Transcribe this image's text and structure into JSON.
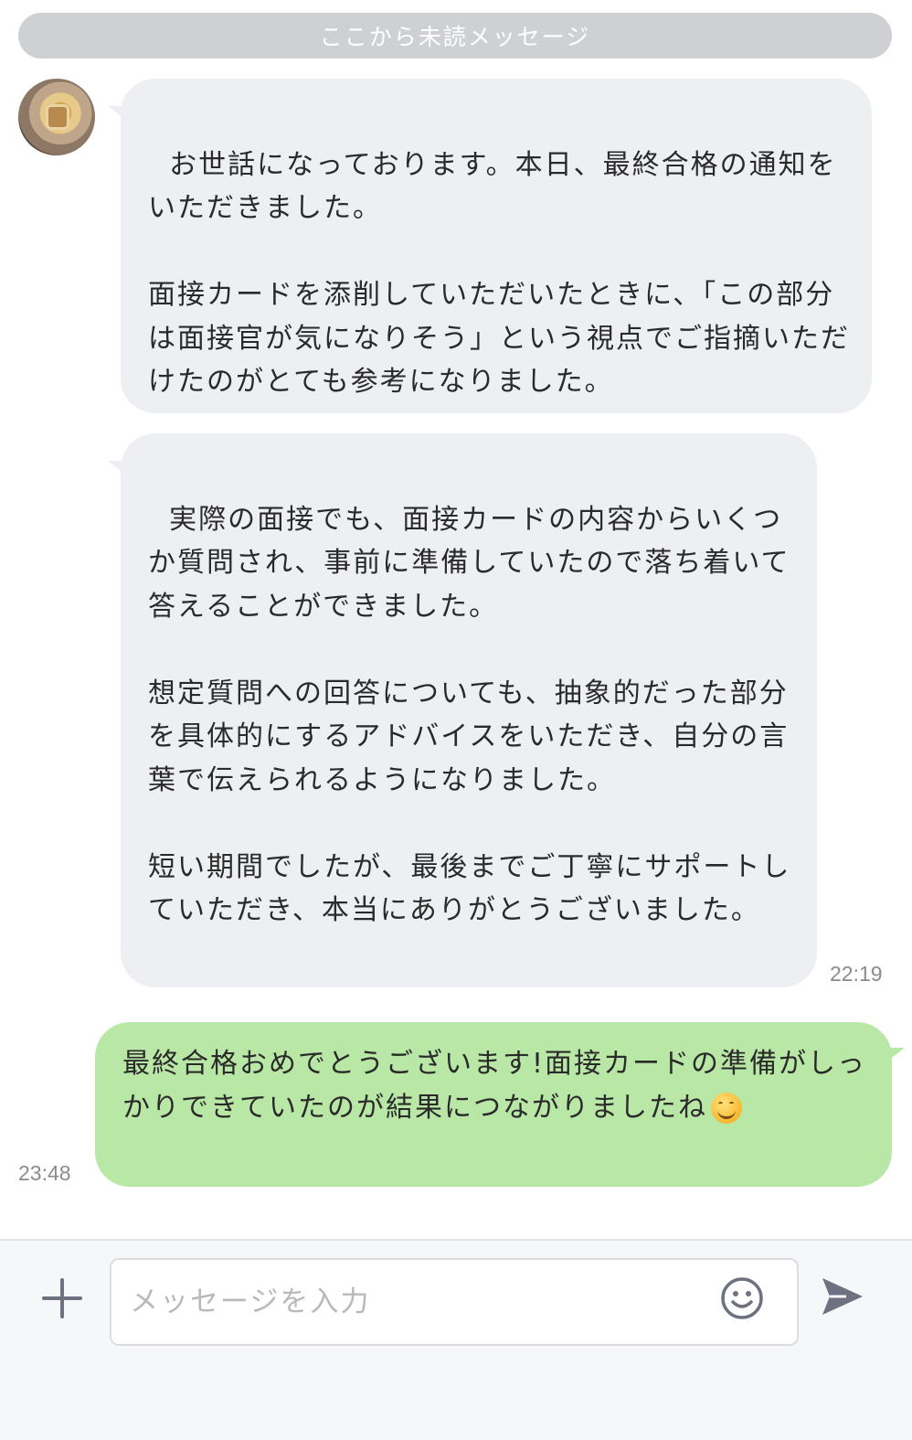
{
  "divider": {
    "label": "ここから未読メッセージ"
  },
  "messages": [
    {
      "direction": "incoming",
      "text": "お世話になっております。本日、最終合格の通知をいただきました。\n\n面接カードを添削していただいたときに、「この部分は面接官が気になりそう」という視点でご指摘いただけたのがとても参考になりました。"
    },
    {
      "direction": "incoming",
      "text": "実際の面接でも、面接カードの内容からいくつか質問され、事前に準備していたので落ち着いて答えることができました。\n\n想定質問への回答についても、抽象的だった部分を具体的にするアドバイスをいただき、自分の言葉で伝えられるようになりました。\n\n短い期間でしたが、最後までご丁寧にサポートしていただき、本当にありがとうございました。",
      "time": "22:19"
    },
    {
      "direction": "outgoing",
      "text": "最終合格おめでとうございます!面接カードの準備がしっかりできていたのが結果につながりましたね",
      "emoji": "smiling-face",
      "time": "23:48"
    }
  ],
  "composer": {
    "placeholder": "メッセージを入力",
    "value": ""
  },
  "icons": {
    "plus": "plus-icon",
    "emoji": "smiley-icon",
    "send": "send-icon"
  },
  "colors": {
    "incoming_bubble": "#eeeff3",
    "outgoing_bubble": "#b9e7a6",
    "divider": "#cfd0d3",
    "icon": "#6e7280"
  }
}
